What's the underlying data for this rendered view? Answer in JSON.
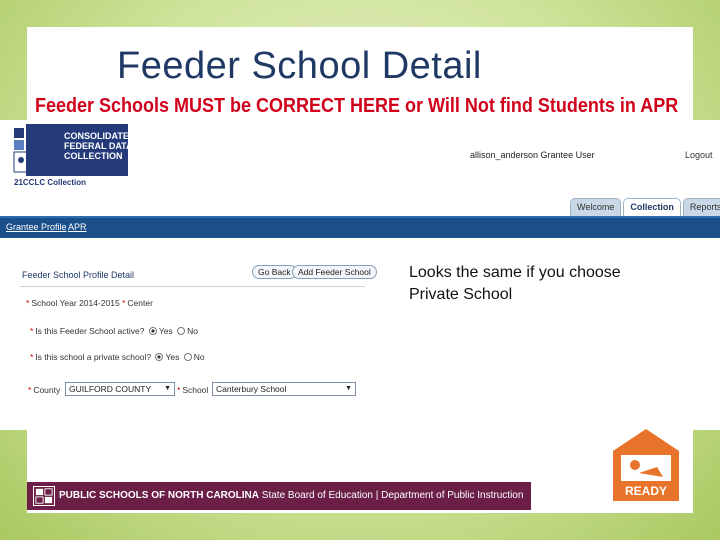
{
  "slide": {
    "title": "Feeder School Detail",
    "warning": "Feeder Schools MUST be CORRECT HERE or Will Not find Students in APR"
  },
  "app": {
    "logo_lines": [
      "CONSOLIDATED",
      "FEDERAL DATA",
      "COLLECTION"
    ],
    "logo_sub": "21CCLC Collection",
    "user": "allison_anderson Grantee User",
    "logout": "Logout",
    "tabs": [
      "Welcome",
      "Collection",
      "Reports"
    ],
    "active_tab": "Collection",
    "nav": [
      "Grantee Profile",
      "APR"
    ]
  },
  "form": {
    "title": "Feeder School Profile Detail",
    "go_back": "Go Back",
    "add_feeder": "Add Feeder School",
    "school_year_label": "School Year",
    "school_year_value": "2014-2015",
    "center_label": "Center",
    "active_label": "Is this Feeder School active?",
    "private_label": "Is this school a private school?",
    "yes": "Yes",
    "no": "No",
    "county_label": "County",
    "county_value": "GUILFORD COUNTY",
    "school_label": "School",
    "school_value": "Canterbury School"
  },
  "note": {
    "line1": "Looks the same if  you choose",
    "line2": "Private School"
  },
  "footer": {
    "org": "PUBLIC SCHOOLS OF NORTH CAROLINA",
    "rest": " State Board of Education | Department of Public Instruction"
  },
  "ready_badge": "READY",
  "colors": {
    "title": "#1f3864",
    "warning": "#d0021b",
    "nav": "#1b4f8a",
    "footer": "#6b1f47",
    "ready": "#e8732a"
  }
}
